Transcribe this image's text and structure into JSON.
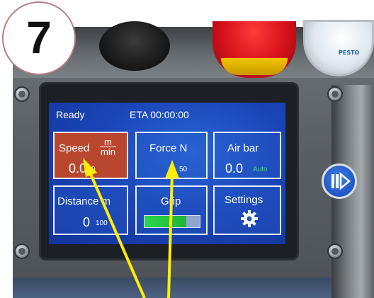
{
  "step_badge": "7",
  "screen": {
    "status": "Ready",
    "eta": "ETA 00:00:00",
    "tiles": {
      "speed": {
        "label": "Speed",
        "unit_num": "m",
        "unit_den": "min",
        "value": "0.0",
        "setpoint": "0",
        "state": "selected"
      },
      "force": {
        "label": "Force N",
        "setpoint": "50"
      },
      "air": {
        "label": "Air bar",
        "value": "0.0",
        "mode": "Auto"
      },
      "distance": {
        "label": "Distance m",
        "value": "0",
        "setpoint": "100"
      },
      "grip": {
        "label": "Grip",
        "level_fraction": 0.75
      },
      "settings": {
        "label": "Settings",
        "icon": "gear-icon"
      }
    }
  },
  "side_button": {
    "icon": "play-pause-icon"
  },
  "gauge_label": "PESTO",
  "colors": {
    "screen_blue": "#1b46b8",
    "speed_tile": "#b9472f",
    "auto_green": "#38e04e",
    "arrow_yellow": "#ffee00",
    "estop_red": "#d4101a"
  }
}
